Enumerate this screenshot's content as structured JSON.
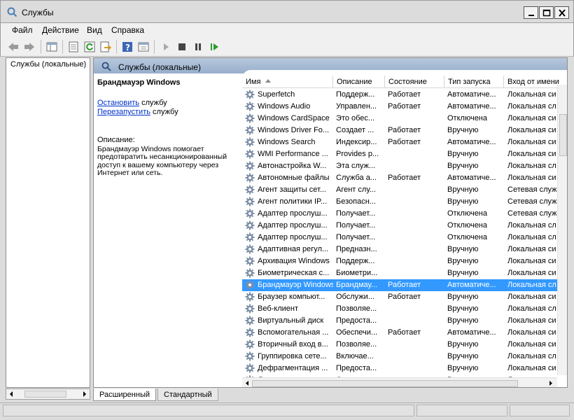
{
  "window": {
    "title": "Службы"
  },
  "menu": [
    "Файл",
    "Действие",
    "Вид",
    "Справка"
  ],
  "tree": {
    "node": "Службы (локальные)"
  },
  "header": {
    "title": "Службы (локальные)"
  },
  "details": {
    "service_name": "Брандмауэр Windows",
    "stop_link": "Остановить",
    "stop_suffix": " службу",
    "restart_link": "Перезапустить",
    "restart_suffix": " службу",
    "description_label": "Описание:",
    "description_text": "Брандмауэр Windows помогает предотвратить несанкционированный доступ к вашему компьютеру через Интернет или сеть."
  },
  "columns": [
    "Имя",
    "Описание",
    "Состояние",
    "Тип запуска",
    "Вход от имени"
  ],
  "rows": [
    [
      "Superfetch",
      "Поддерж...",
      "Работает",
      "Автоматиче...",
      "Локальная си"
    ],
    [
      "Windows Audio",
      "Управлен...",
      "Работает",
      "Автоматиче...",
      "Локальная сл"
    ],
    [
      "Windows CardSpace",
      "Это обес...",
      "",
      "Отключена",
      "Локальная си"
    ],
    [
      "Windows Driver Fo...",
      "Создает ...",
      "Работает",
      "Вручную",
      "Локальная си"
    ],
    [
      "Windows Search",
      "Индексир...",
      "Работает",
      "Автоматиче...",
      "Локальная си"
    ],
    [
      "WMI Performance ...",
      "Provides p...",
      "",
      "Вручную",
      "Локальная си"
    ],
    [
      "Автонастройка W...",
      "Эта служ...",
      "",
      "Вручную",
      "Локальная сл"
    ],
    [
      "Автономные файлы",
      "Служба а...",
      "Работает",
      "Автоматиче...",
      "Локальная си"
    ],
    [
      "Агент защиты сет...",
      "Агент слу...",
      "",
      "Вручную",
      "Сетевая служ"
    ],
    [
      "Агент политики IP...",
      "Безопасн...",
      "",
      "Вручную",
      "Сетевая служ"
    ],
    [
      "Адаптер прослуш...",
      "Получает...",
      "",
      "Отключена",
      "Сетевая служ"
    ],
    [
      "Адаптер прослуш...",
      "Получает...",
      "",
      "Отключена",
      "Локальная сл"
    ],
    [
      "Адаптер прослуш...",
      "Получает...",
      "",
      "Отключена",
      "Локальная сл"
    ],
    [
      "Адаптивная регул...",
      "Предназн...",
      "",
      "Вручную",
      "Локальная си"
    ],
    [
      "Архивация Windows",
      "Поддерж...",
      "",
      "Вручную",
      "Локальная си"
    ],
    [
      "Биометрическая с...",
      "Биометри...",
      "",
      "Вручную",
      "Локальная си"
    ],
    [
      "Брандмауэр Windows",
      "Брандмау...",
      "Работает",
      "Автоматиче...",
      "Локальная сл"
    ],
    [
      "Браузер компьют...",
      "Обслужи...",
      "Работает",
      "Вручную",
      "Локальная си"
    ],
    [
      "Веб-клиент",
      "Позволяе...",
      "",
      "Вручную",
      "Локальная сл"
    ],
    [
      "Виртуальный диск",
      "Предоста...",
      "",
      "Вручную",
      "Локальная си"
    ],
    [
      "Вспомогательная ...",
      "Обеспечи...",
      "Работает",
      "Автоматиче...",
      "Локальная си"
    ],
    [
      "Вторичный вход в...",
      "Позволяе...",
      "",
      "Вручную",
      "Локальная си"
    ],
    [
      "Группировка сете...",
      "Включае...",
      "",
      "Вручную",
      "Локальная сл"
    ],
    [
      "Дефрагментация ...",
      "Предоста...",
      "",
      "Вручную",
      "Локальная си"
    ],
    [
      "Диспетчер автоп...",
      "Создает ...",
      "",
      "Вручную",
      "Локальная си"
    ]
  ],
  "selected_row": 16,
  "tabs": [
    "Расширенный",
    "Стандартный"
  ],
  "colors": {
    "selection": "#3399ff",
    "header_band": "#a7bbd4",
    "link": "#0033cc"
  },
  "icons": {
    "window": "services-icon",
    "toolbar": [
      "back-icon",
      "forward-icon",
      "show-tree-icon",
      "properties-icon",
      "refresh-icon",
      "export-icon",
      "help-icon",
      "view-icon",
      "start-icon",
      "stop-icon",
      "pause-icon",
      "restart-icon"
    ],
    "row": "gear-icon"
  }
}
